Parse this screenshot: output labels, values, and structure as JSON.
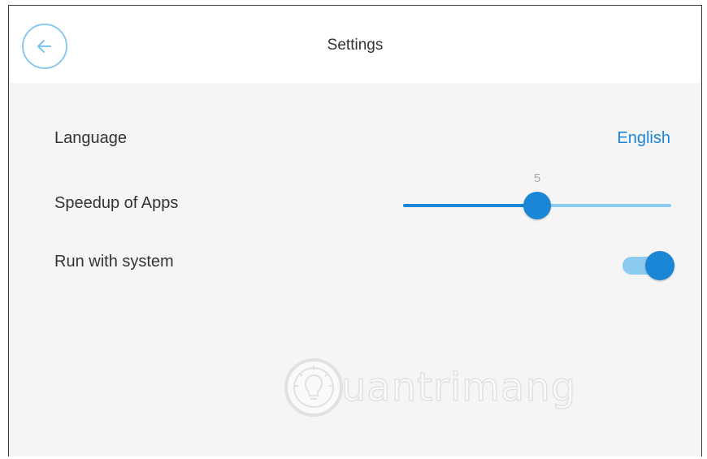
{
  "header": {
    "title": "Settings",
    "back_icon": "arrow-left-icon"
  },
  "settings": {
    "language": {
      "label": "Language",
      "value": "English"
    },
    "speedup": {
      "label": "Speedup of Apps",
      "value": "5",
      "level_fraction": 0.5
    },
    "run_with_system": {
      "label": "Run with system",
      "enabled": true
    }
  },
  "watermark": {
    "text": "uantrimang",
    "icon": "lightbulb-logo"
  },
  "colors": {
    "accent": "#1a86d6",
    "accent_light": "#8ccaf0",
    "background": "#f5f5f6",
    "text": "#333333"
  }
}
